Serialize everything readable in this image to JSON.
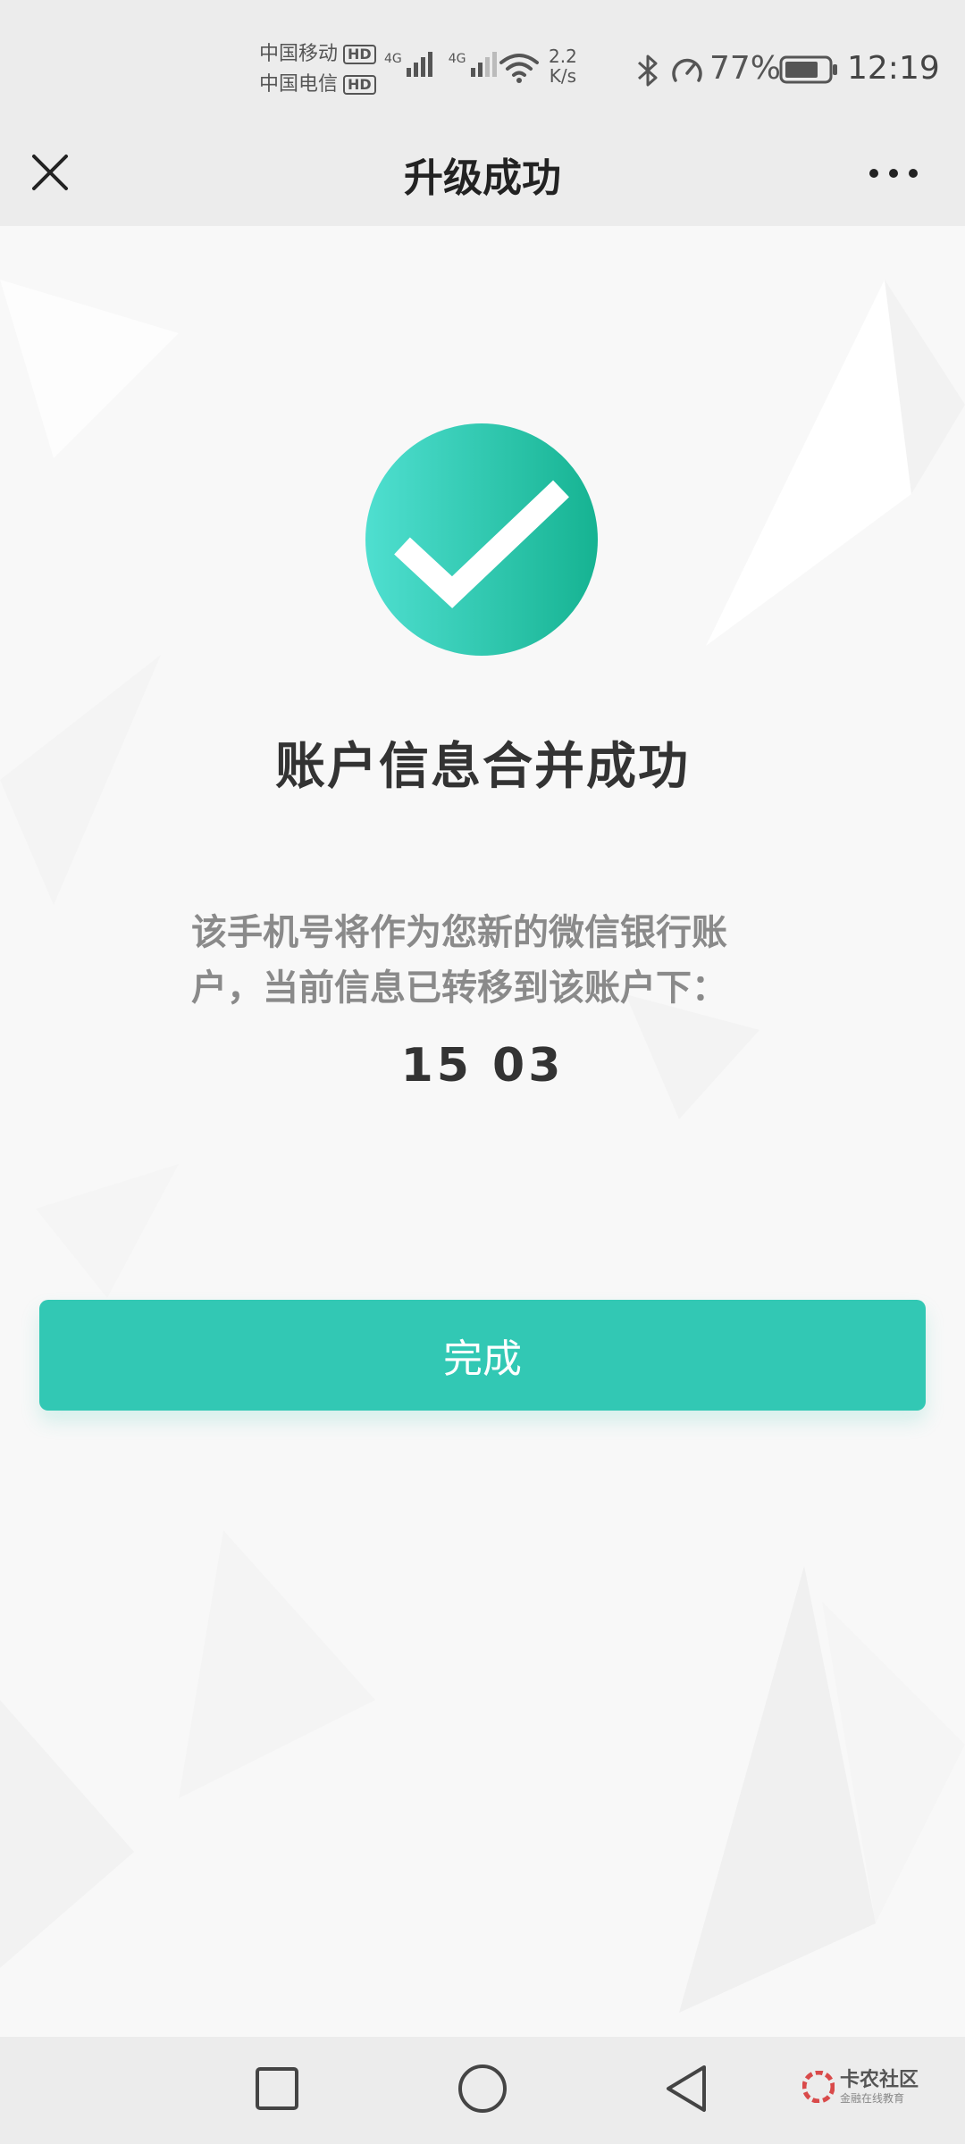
{
  "status_bar": {
    "carrier_1": "中国移动",
    "carrier_2": "中国电信",
    "hd_badge": "HD",
    "network_type": "4G",
    "net_speed_value": "2.2",
    "net_speed_unit": "K/s",
    "battery_percent": "77%",
    "time": "12:19"
  },
  "header": {
    "title": "升级成功",
    "close_icon": "close-icon",
    "more_icon": "more-icon"
  },
  "result": {
    "icon": "check-circle-icon",
    "icon_color": "#2ec9b3",
    "title": "账户信息合并成功",
    "description_line_1": "该手机号将作为您新的微信银行账",
    "description_line_2": "户，当前信息已转移到该账户下：",
    "phone_number": "15         03"
  },
  "actions": {
    "done_label": "完成",
    "done_color": "#32c8b4"
  },
  "nav_bar": {
    "watermark_title": "卡农社区",
    "watermark_subtitle": "金融在线教育"
  }
}
